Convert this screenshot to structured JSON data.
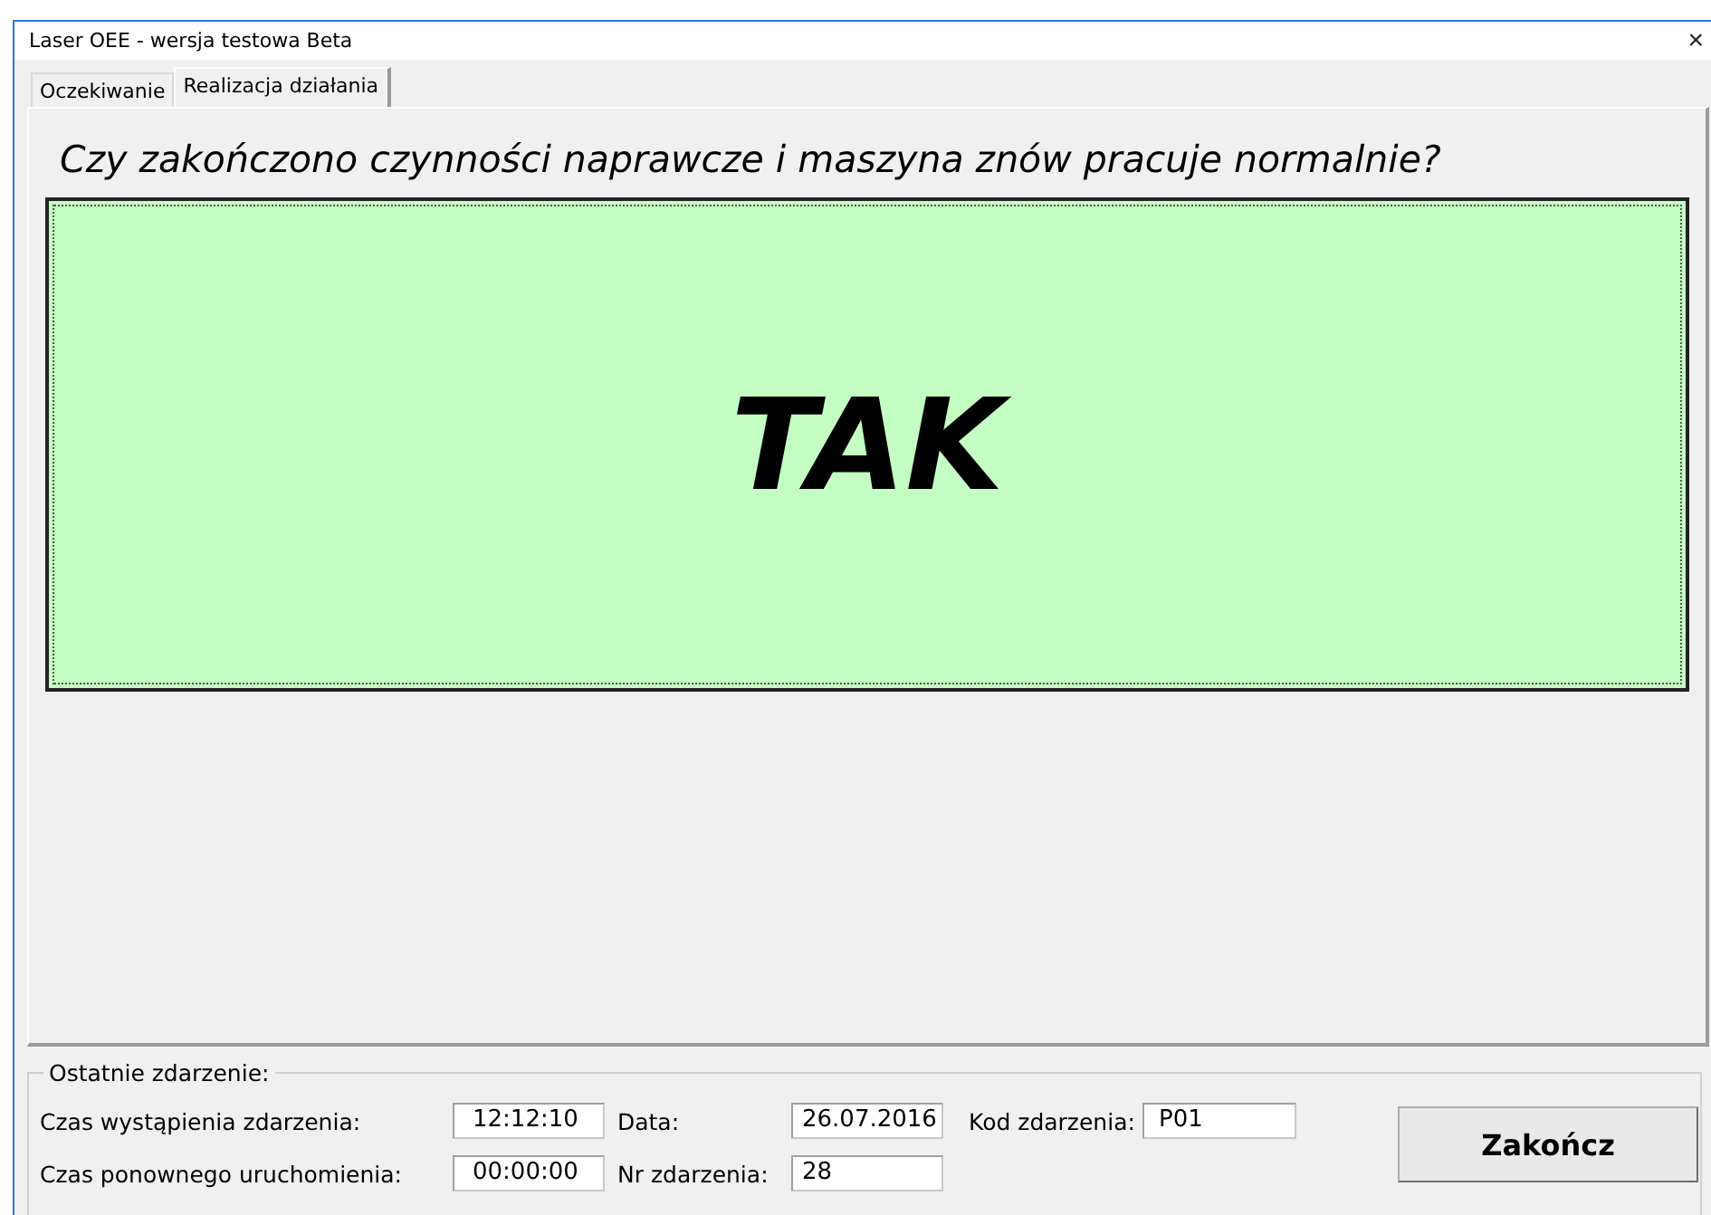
{
  "window": {
    "title": "Laser OEE - wersja testowa Beta",
    "close": "×"
  },
  "tabs": [
    {
      "label": "Oczekiwanie",
      "selected": false
    },
    {
      "label": "Realizacja działania",
      "selected": true
    }
  ],
  "question": "Czy zakończono czynności naprawcze i maszyna znów pracuje normalnie?",
  "answer_button": {
    "label": "TAK"
  },
  "last_event": {
    "legend": "Ostatnie zdarzenie:",
    "fields": [
      {
        "label": "Czas wystąpienia zdarzenia:",
        "value": "12:12:10"
      },
      {
        "label": "Data:",
        "value": "26.07.2016"
      },
      {
        "label": "Kod zdarzenia:",
        "value": "P01"
      },
      {
        "label": "Czas ponownego uruchomienia:",
        "value": "00:00:00"
      },
      {
        "label": "Nr zdarzenia:",
        "value": "28"
      }
    ]
  },
  "finish_button": {
    "label": "Zakończ"
  }
}
